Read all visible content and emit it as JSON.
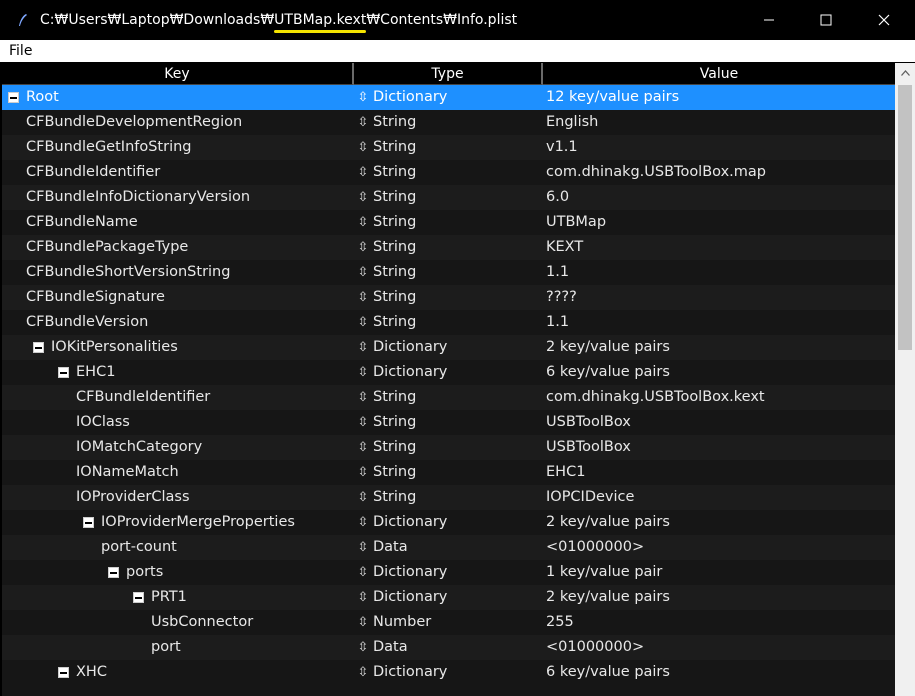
{
  "window": {
    "title_prefix": "C:₩Users₩Laptop₩Downloads₩",
    "title_highlight": "UTBMap.kext",
    "title_suffix": "₩Contents₩Info.plist",
    "highlight_color": "#f5e400"
  },
  "menu": {
    "file": "File"
  },
  "columns": {
    "key": "Key",
    "type": "Type",
    "value": "Value"
  },
  "rows": [
    {
      "key": "Root",
      "level": 0,
      "toggle": true,
      "type": "Dictionary",
      "value": "12 key/value pairs",
      "selected": true
    },
    {
      "key": "CFBundleDevelopmentRegion",
      "level": 1,
      "toggle": false,
      "type": "String",
      "value": "English"
    },
    {
      "key": "CFBundleGetInfoString",
      "level": 1,
      "toggle": false,
      "type": "String",
      "value": "v1.1"
    },
    {
      "key": "CFBundleIdentifier",
      "level": 1,
      "toggle": false,
      "type": "String",
      "value": "com.dhinakg.USBToolBox.map"
    },
    {
      "key": "CFBundleInfoDictionaryVersion",
      "level": 1,
      "toggle": false,
      "type": "String",
      "value": "6.0"
    },
    {
      "key": "CFBundleName",
      "level": 1,
      "toggle": false,
      "type": "String",
      "value": "UTBMap"
    },
    {
      "key": "CFBundlePackageType",
      "level": 1,
      "toggle": false,
      "type": "String",
      "value": "KEXT"
    },
    {
      "key": "CFBundleShortVersionString",
      "level": 1,
      "toggle": false,
      "type": "String",
      "value": "1.1"
    },
    {
      "key": "CFBundleSignature",
      "level": 1,
      "toggle": false,
      "type": "String",
      "value": "????"
    },
    {
      "key": "CFBundleVersion",
      "level": 1,
      "toggle": false,
      "type": "String",
      "value": "1.1"
    },
    {
      "key": "IOKitPersonalities",
      "level": 1,
      "toggle": true,
      "type": "Dictionary",
      "value": "2 key/value pairs"
    },
    {
      "key": "EHC1",
      "level": 2,
      "toggle": true,
      "type": "Dictionary",
      "value": "6 key/value pairs"
    },
    {
      "key": "CFBundleIdentifier",
      "level": 3,
      "toggle": false,
      "type": "String",
      "value": "com.dhinakg.USBToolBox.kext"
    },
    {
      "key": "IOClass",
      "level": 3,
      "toggle": false,
      "type": "String",
      "value": "USBToolBox"
    },
    {
      "key": "IOMatchCategory",
      "level": 3,
      "toggle": false,
      "type": "String",
      "value": "USBToolBox"
    },
    {
      "key": "IONameMatch",
      "level": 3,
      "toggle": false,
      "type": "String",
      "value": "EHC1"
    },
    {
      "key": "IOProviderClass",
      "level": 3,
      "toggle": false,
      "type": "String",
      "value": "IOPCIDevice"
    },
    {
      "key": "IOProviderMergeProperties",
      "level": 3,
      "toggle": true,
      "type": "Dictionary",
      "value": "2 key/value pairs"
    },
    {
      "key": "port-count",
      "level": 4,
      "toggle": false,
      "type": "Data",
      "value": "<01000000>"
    },
    {
      "key": "ports",
      "level": 4,
      "toggle": true,
      "type": "Dictionary",
      "value": "1 key/value pair"
    },
    {
      "key": "PRT1",
      "level": 5,
      "toggle": true,
      "type": "Dictionary",
      "value": "2 key/value pairs"
    },
    {
      "key": "UsbConnector",
      "level": 6,
      "toggle": false,
      "type": "Number",
      "value": "255"
    },
    {
      "key": "port",
      "level": 6,
      "toggle": false,
      "type": "Data",
      "value": "<01000000>"
    },
    {
      "key": "XHC",
      "level": 2,
      "toggle": true,
      "type": "Dictionary",
      "value": "6 key/value pairs"
    }
  ]
}
